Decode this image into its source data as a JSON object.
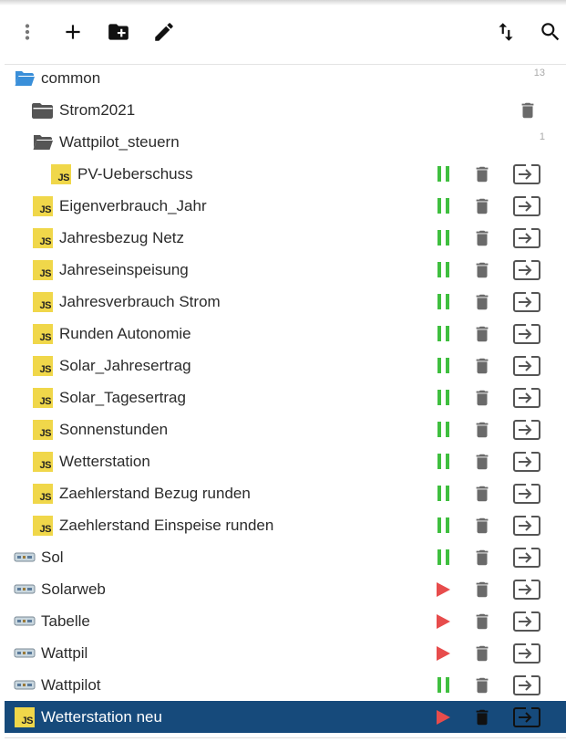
{
  "toolbar": {
    "buttons": [
      {
        "name": "more-menu-button",
        "icon": "more-vert-icon"
      },
      {
        "name": "add-script-button",
        "icon": "add-icon"
      },
      {
        "name": "add-folder-button",
        "icon": "create-new-folder-icon"
      },
      {
        "name": "rename-button",
        "icon": "edit-pencil-icon"
      },
      {
        "name": "sort-button",
        "icon": "swap-vert-icon"
      },
      {
        "name": "search-button",
        "icon": "search-icon"
      }
    ]
  },
  "colors": {
    "running": "#3fbf3f",
    "stopped": "#e74c4c",
    "selected_bg": "#164a7b",
    "js_badge": "#f0d74a",
    "folder_open": "#3a8fd9"
  },
  "tree": {
    "items": [
      {
        "type": "folder-open-root",
        "label": "common",
        "count": "13",
        "level": 0
      },
      {
        "type": "folder",
        "label": "Strom2021",
        "level": 1,
        "delete_only": true
      },
      {
        "type": "folder-open",
        "label": "Wattpilot_steuern",
        "count": "1",
        "level": 1
      },
      {
        "type": "js",
        "label": "PV-Ueberschuss",
        "level": 2,
        "state": "running"
      },
      {
        "type": "js",
        "label": "Eigenverbrauch_Jahr",
        "level": 1,
        "state": "running"
      },
      {
        "type": "js",
        "label": "Jahresbezug Netz",
        "level": 1,
        "state": "running"
      },
      {
        "type": "js",
        "label": "Jahreseinspeisung",
        "level": 1,
        "state": "running"
      },
      {
        "type": "js",
        "label": "Jahresverbrauch Strom",
        "level": 1,
        "state": "running"
      },
      {
        "type": "js",
        "label": "Runden Autonomie",
        "level": 1,
        "state": "running"
      },
      {
        "type": "js",
        "label": "Solar_Jahresertrag",
        "level": 1,
        "state": "running"
      },
      {
        "type": "js",
        "label": "Solar_Tagesertrag",
        "level": 1,
        "state": "running"
      },
      {
        "type": "js",
        "label": "Sonnenstunden",
        "level": 1,
        "state": "running"
      },
      {
        "type": "js",
        "label": "Wetterstation",
        "level": 1,
        "state": "running"
      },
      {
        "type": "js",
        "label": "Zaehlerstand Bezug runden",
        "level": 1,
        "state": "running"
      },
      {
        "type": "js",
        "label": "Zaehlerstand Einspeise runden",
        "level": 1,
        "state": "running"
      },
      {
        "type": "blockly",
        "label": "Sol",
        "level": 0,
        "state": "running"
      },
      {
        "type": "blockly",
        "label": "Solarweb",
        "level": 0,
        "state": "stopped"
      },
      {
        "type": "blockly",
        "label": "Tabelle",
        "level": 0,
        "state": "stopped"
      },
      {
        "type": "blockly",
        "label": "Wattpil",
        "level": 0,
        "state": "stopped"
      },
      {
        "type": "blockly",
        "label": "Wattpilot",
        "level": 0,
        "state": "running"
      },
      {
        "type": "js",
        "label": "Wetterstation neu",
        "level": 0,
        "state": "stopped",
        "selected": true
      }
    ]
  }
}
